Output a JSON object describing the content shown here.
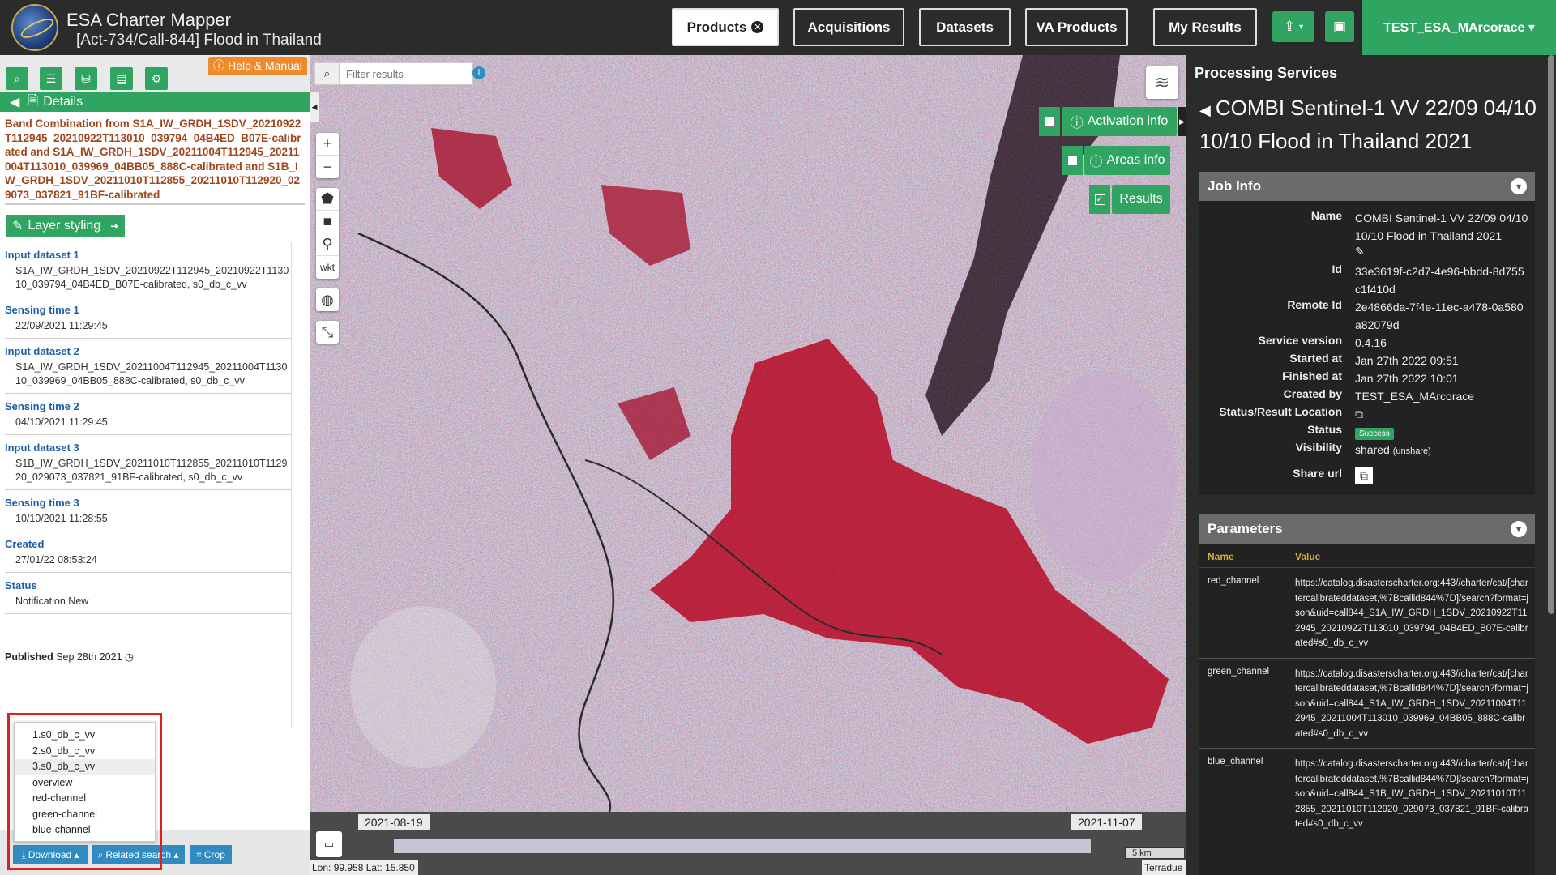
{
  "header": {
    "app_title": "ESA Charter Mapper",
    "app_subtitle": "[Act-734/Call-844] Flood in Thailand",
    "nav": [
      "Products",
      "Acquisitions",
      "Datasets",
      "VA Products",
      "My Results"
    ],
    "user": "TEST_ESA_MArcorace ▾"
  },
  "left": {
    "help_label": "Help & Manual",
    "details_label": "Details",
    "title": "Band Combination from S1A_IW_GRDH_1SDV_20210922T112945_20210922T113010_039794_04B4ED_B07E-calibrated and S1A_IW_GRDH_1SDV_20211004T112945_20211004T113010_039969_04BB05_888C-calibrated and S1B_IW_GRDH_1SDV_20211010T112855_20211010T112920_029073_037821_91BF-calibrated",
    "layer_styling": "Layer styling",
    "fields": [
      {
        "label": "Input dataset 1",
        "value": "S1A_IW_GRDH_1SDV_20210922T112945_20210922T113010_039794_04B4ED_B07E-calibrated, s0_db_c_vv"
      },
      {
        "label": "Sensing time 1",
        "value": "22/09/2021 11:29:45"
      },
      {
        "label": "Input dataset 2",
        "value": "S1A_IW_GRDH_1SDV_20211004T112945_20211004T113010_039969_04BB05_888C-calibrated, s0_db_c_vv"
      },
      {
        "label": "Sensing time 2",
        "value": "04/10/2021 11:29:45"
      },
      {
        "label": "Input dataset 3",
        "value": "S1B_IW_GRDH_1SDV_20211010T112855_20211010T112920_029073_037821_91BF-calibrated, s0_db_c_vv"
      },
      {
        "label": "Sensing time 3",
        "value": "10/10/2021 11:28:55"
      },
      {
        "label": "Created",
        "value": "27/01/22 08:53:24"
      },
      {
        "label": "Status",
        "value": "Notification New"
      }
    ],
    "published_label": "Published",
    "published_date": "Sep 28th 2021",
    "dropdown": [
      "1.s0_db_c_vv",
      "2.s0_db_c_vv",
      "3.s0_db_c_vv",
      "overview",
      "red-channel",
      "green-channel",
      "blue-channel"
    ],
    "actions": {
      "download": "Download ▴",
      "related": "Related search ▴",
      "crop": "Crop"
    }
  },
  "map": {
    "filter_placeholder": "Filter results",
    "activation_info": "Activation info",
    "areas_info": "Areas info",
    "results": "Results",
    "date_start": "2021-08-19",
    "date_end": "2021-11-07",
    "scale": "5 km",
    "coords": "Lon: 99.958 Lat: 15.850",
    "attribution": "Terradue",
    "draw_tools": [
      "pentagon-icon",
      "square-icon",
      "marker-icon",
      "wkt"
    ]
  },
  "right": {
    "ps_title": "Processing Services",
    "job_title": "COMBI Sentinel-1 VV 22/09 04/10 10/10 Flood in Thailand 2021",
    "job_info_label": "Job Info",
    "job_info": [
      {
        "k": "Name",
        "v": "COMBI Sentinel-1 VV 22/09 04/10 10/10 Flood in Thailand 2021"
      },
      {
        "k": "Id",
        "v": "33e3619f-c2d7-4e96-bbdd-8d755c1f410d"
      },
      {
        "k": "Remote Id",
        "v": "2e4866da-7f4e-11ec-a478-0a580a82079d"
      },
      {
        "k": "Service version",
        "v": "0.4.16"
      },
      {
        "k": "Started at",
        "v": "Jan 27th 2022 09:51"
      },
      {
        "k": "Finished at",
        "v": "Jan 27th 2022 10:01"
      },
      {
        "k": "Created by",
        "v": "TEST_ESA_MArcorace"
      },
      {
        "k": "Status/Result Location",
        "v": ""
      },
      {
        "k": "Status",
        "v": "Success"
      },
      {
        "k": "Visibility",
        "v": "shared",
        "link": "(unshare)"
      },
      {
        "k": "Share url",
        "v": ""
      }
    ],
    "params_label": "Parameters",
    "params_head": {
      "name": "Name",
      "value": "Value"
    },
    "params": [
      {
        "name": "red_channel",
        "value": "https://catalog.disasterscharter.org:443//charter/cat/[chartercalibrateddataset,%7Bcallid844%7D]/search?format=json&uid=call844_S1A_IW_GRDH_1SDV_20210922T112945_20210922T113010_039794_04B4ED_B07E-calibrated#s0_db_c_vv"
      },
      {
        "name": "green_channel",
        "value": "https://catalog.disasterscharter.org:443//charter/cat/[chartercalibrateddataset,%7Bcallid844%7D]/search?format=json&uid=call844_S1A_IW_GRDH_1SDV_20211004T112945_20211004T113010_039969_04BB05_888C-calibrated#s0_db_c_vv"
      },
      {
        "name": "blue_channel",
        "value": "https://catalog.disasterscharter.org:443//charter/cat/[chartercalibrateddataset,%7Bcallid844%7D]/search?format=json&uid=call844_S1B_IW_GRDH_1SDV_20211010T112855_20211010T112920_029073_037821_91BF-calibrated#s0_db_c_vv"
      }
    ]
  },
  "colors": {
    "accent_green": "#2fa561",
    "orange": "#f08b2c",
    "flood_red": "#c0172a"
  }
}
